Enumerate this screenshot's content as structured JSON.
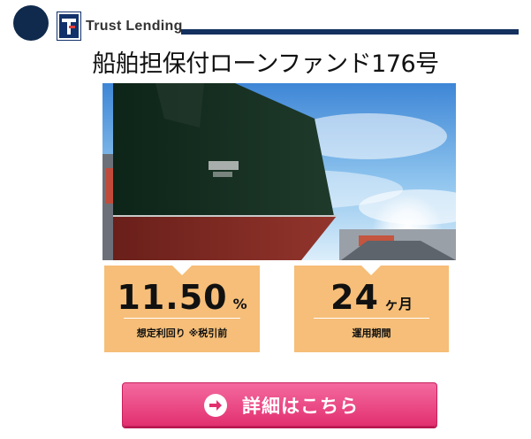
{
  "header": {
    "brand_name": "Trust Lending",
    "logo_icon": "trust-lending-logo",
    "colors": {
      "navy": "#0f2a4c",
      "rule": "#13305e"
    }
  },
  "fund": {
    "title": "船舶担保付ローンファンド176号"
  },
  "hero_image": {
    "subject": "ship-hull-photo"
  },
  "stats": {
    "yield": {
      "value": "11.50",
      "unit": "%",
      "label": "想定利回り ※税引前"
    },
    "term": {
      "value": "24",
      "unit": "ヶ月",
      "label": "運用期間"
    },
    "card_color": "#f6be78"
  },
  "cta": {
    "label": "詳細はこちら",
    "icon": "arrow-right-circle-icon",
    "color": "#e94b86"
  }
}
